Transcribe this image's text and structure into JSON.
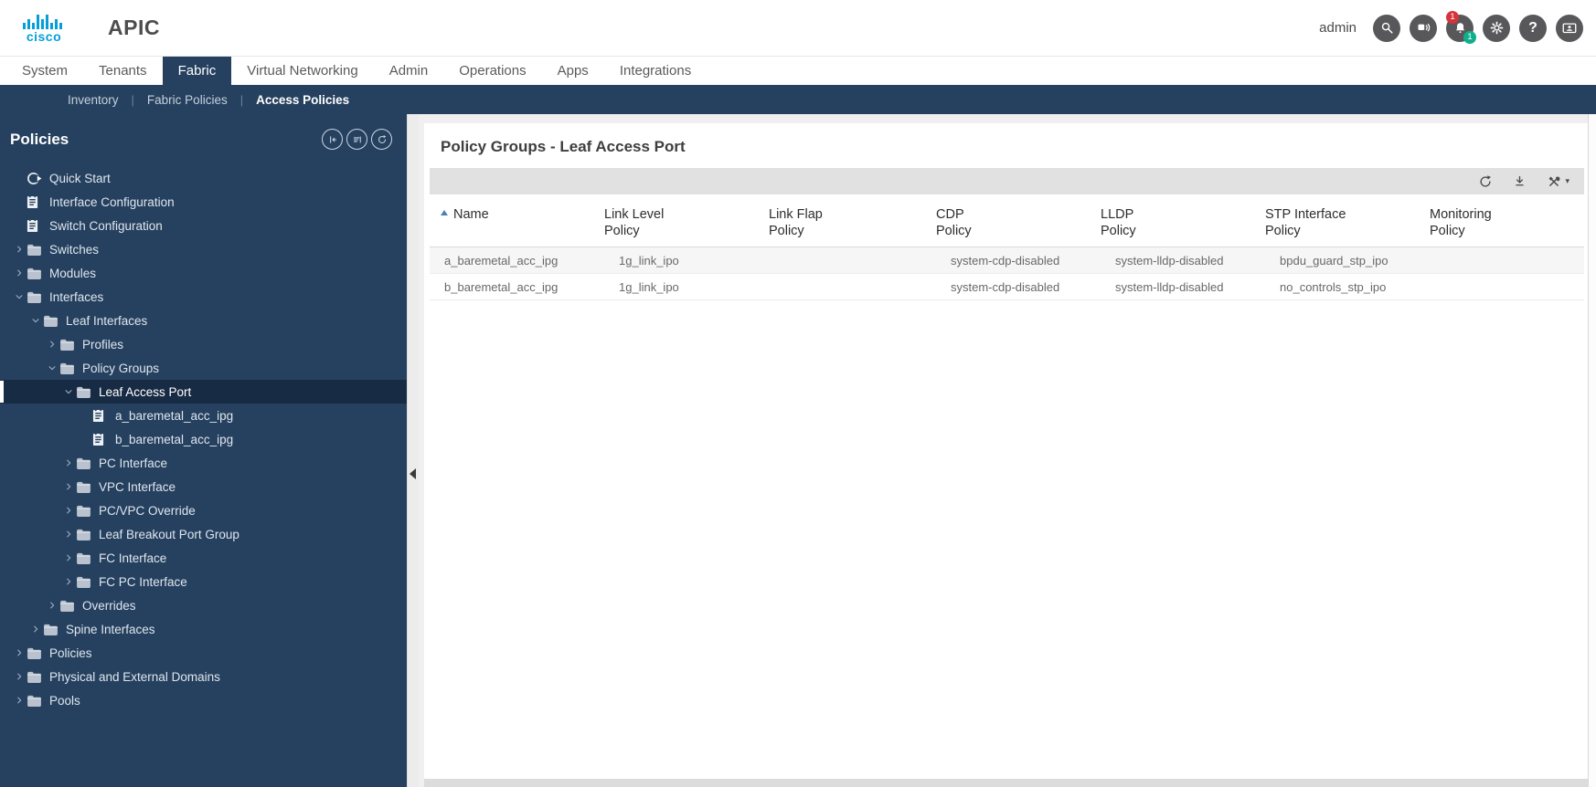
{
  "header": {
    "brand": "cisco",
    "app_title": "APIC",
    "user": "admin",
    "notification_badge_red": "1",
    "notification_badge_teal": "1",
    "help_glyph": "?",
    "icons": [
      "search-icon",
      "walkthrough-icon",
      "notifications-bell-icon",
      "settings-gear-icon",
      "help-icon",
      "system-monitor-icon"
    ]
  },
  "nav": {
    "tabs": [
      {
        "label": "System",
        "active": false
      },
      {
        "label": "Tenants",
        "active": false
      },
      {
        "label": "Fabric",
        "active": true
      },
      {
        "label": "Virtual Networking",
        "active": false
      },
      {
        "label": "Admin",
        "active": false
      },
      {
        "label": "Operations",
        "active": false
      },
      {
        "label": "Apps",
        "active": false
      },
      {
        "label": "Integrations",
        "active": false
      }
    ]
  },
  "subnav": {
    "items": [
      {
        "label": "Inventory",
        "active": false
      },
      {
        "label": "Fabric Policies",
        "active": false
      },
      {
        "label": "Access Policies",
        "active": true
      }
    ]
  },
  "sidebar": {
    "title": "Policies",
    "tools": [
      "collapse-all-icon",
      "filter-icon",
      "refresh-icon"
    ],
    "tree": [
      {
        "label": "Quick Start",
        "depth": 0,
        "icon": "quickstart",
        "caret": "none",
        "selected": false
      },
      {
        "label": "Interface Configuration",
        "depth": 0,
        "icon": "doc",
        "caret": "none",
        "selected": false
      },
      {
        "label": "Switch Configuration",
        "depth": 0,
        "icon": "doc",
        "caret": "none",
        "selected": false
      },
      {
        "label": "Switches",
        "depth": 0,
        "icon": "folder",
        "caret": "collapsed",
        "selected": false
      },
      {
        "label": "Modules",
        "depth": 0,
        "icon": "folder",
        "caret": "collapsed",
        "selected": false
      },
      {
        "label": "Interfaces",
        "depth": 0,
        "icon": "folder",
        "caret": "expanded",
        "selected": false
      },
      {
        "label": "Leaf Interfaces",
        "depth": 1,
        "icon": "folder",
        "caret": "expanded",
        "selected": false
      },
      {
        "label": "Profiles",
        "depth": 2,
        "icon": "folder",
        "caret": "collapsed",
        "selected": false
      },
      {
        "label": "Policy Groups",
        "depth": 2,
        "icon": "folder",
        "caret": "expanded",
        "selected": false
      },
      {
        "label": "Leaf Access Port",
        "depth": 3,
        "icon": "folder",
        "caret": "expanded",
        "selected": true
      },
      {
        "label": "a_baremetal_acc_ipg",
        "depth": 4,
        "icon": "doc",
        "caret": "none",
        "selected": false
      },
      {
        "label": "b_baremetal_acc_ipg",
        "depth": 4,
        "icon": "doc",
        "caret": "none",
        "selected": false
      },
      {
        "label": "PC Interface",
        "depth": 3,
        "icon": "folder",
        "caret": "collapsed",
        "selected": false
      },
      {
        "label": "VPC Interface",
        "depth": 3,
        "icon": "folder",
        "caret": "collapsed",
        "selected": false
      },
      {
        "label": "PC/VPC Override",
        "depth": 3,
        "icon": "folder",
        "caret": "collapsed",
        "selected": false
      },
      {
        "label": "Leaf Breakout Port Group",
        "depth": 3,
        "icon": "folder",
        "caret": "collapsed",
        "selected": false
      },
      {
        "label": "FC Interface",
        "depth": 3,
        "icon": "folder",
        "caret": "collapsed",
        "selected": false
      },
      {
        "label": "FC PC Interface",
        "depth": 3,
        "icon": "folder",
        "caret": "collapsed",
        "selected": false
      },
      {
        "label": "Overrides",
        "depth": 2,
        "icon": "folder",
        "caret": "collapsed",
        "selected": false
      },
      {
        "label": "Spine Interfaces",
        "depth": 1,
        "icon": "folder",
        "caret": "collapsed",
        "selected": false
      },
      {
        "label": "Policies",
        "depth": 0,
        "icon": "folder",
        "caret": "collapsed",
        "selected": false
      },
      {
        "label": "Physical and External Domains",
        "depth": 0,
        "icon": "folder",
        "caret": "collapsed",
        "selected": false
      },
      {
        "label": "Pools",
        "depth": 0,
        "icon": "folder",
        "caret": "collapsed",
        "selected": false
      }
    ]
  },
  "main": {
    "title": "Policy Groups - Leaf Access Port",
    "toolbar_icons": [
      "refresh-icon",
      "download-icon",
      "tools-icon"
    ],
    "table": {
      "columns": [
        {
          "line1": "Name",
          "line2": ""
        },
        {
          "line1": "Link Level",
          "line2": "Policy"
        },
        {
          "line1": "Link Flap",
          "line2": "Policy"
        },
        {
          "line1": "CDP",
          "line2": "Policy"
        },
        {
          "line1": "LLDP",
          "line2": "Policy"
        },
        {
          "line1": "STP Interface",
          "line2": "Policy"
        },
        {
          "line1": "Monitoring",
          "line2": "Policy"
        }
      ],
      "rows": [
        [
          "a_baremetal_acc_ipg",
          "1g_link_ipo",
          "",
          "system-cdp-disabled",
          "system-lldp-disabled",
          "bpdu_guard_stp_ipo",
          ""
        ],
        [
          "b_baremetal_acc_ipg",
          "1g_link_ipo",
          "",
          "system-cdp-disabled",
          "system-lldp-disabled",
          "no_controls_stp_ipo",
          ""
        ]
      ]
    }
  },
  "colors": {
    "navy": "#26415f",
    "tree_selected": "#182b44",
    "cisco_blue": "#049fd9",
    "badge_red": "#d6343c",
    "badge_teal": "#0faf8e",
    "toolbar_gray": "#e1e1e1",
    "row_alt_gray": "#f6f6f6",
    "sort_arrow_blue": "#4a7fb5"
  }
}
